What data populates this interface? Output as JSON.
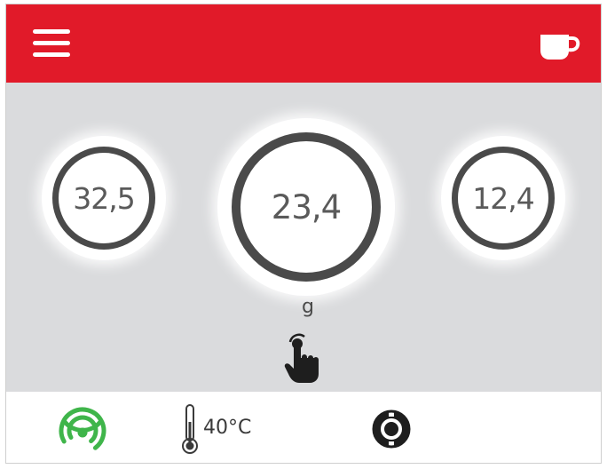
{
  "header": {
    "background_color": "#e11a29",
    "menu_icon": "hamburger-menu-icon",
    "cup_icon": "coffee-cup-icon"
  },
  "doses": [
    {
      "value": "32,5",
      "size": "small"
    },
    {
      "value": "23,4",
      "size": "large",
      "selected": true
    },
    {
      "value": "12,4",
      "size": "small"
    }
  ],
  "unit": "g",
  "hand_icon": "tap-hand-icon",
  "status": {
    "connection_icon": "wifi-connected-icon",
    "connection_color": "#3fb54a",
    "temperature": "40°C",
    "temperature_icon": "thermometer-icon",
    "settings_icon": "grinder-settings-icon"
  }
}
